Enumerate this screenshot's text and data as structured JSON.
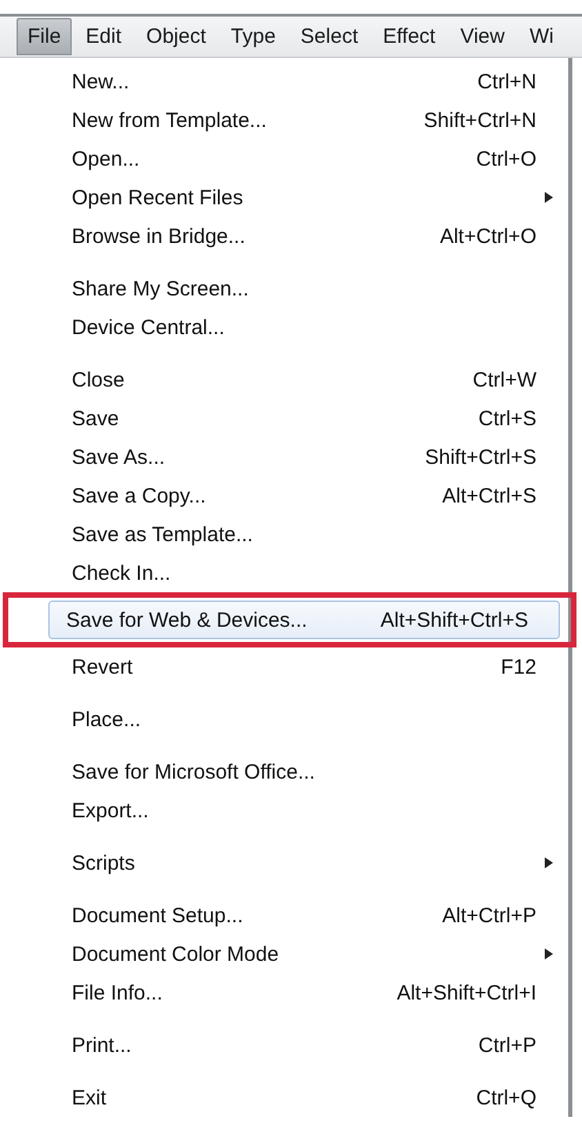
{
  "menu_bar": [
    {
      "label": "File",
      "selected": true
    },
    {
      "label": "Edit",
      "selected": false
    },
    {
      "label": "Object",
      "selected": false
    },
    {
      "label": "Type",
      "selected": false
    },
    {
      "label": "Select",
      "selected": false
    },
    {
      "label": "Effect",
      "selected": false
    },
    {
      "label": "View",
      "selected": false
    },
    {
      "label": "Wi",
      "selected": false
    }
  ],
  "file_menu": {
    "groups": [
      [
        {
          "label": "New...",
          "shortcut": "Ctrl+N",
          "submenu": false,
          "selected": false
        },
        {
          "label": "New from Template...",
          "shortcut": "Shift+Ctrl+N",
          "submenu": false,
          "selected": false
        },
        {
          "label": "Open...",
          "shortcut": "Ctrl+O",
          "submenu": false,
          "selected": false
        },
        {
          "label": "Open Recent Files",
          "submenu": true,
          "selected": false
        },
        {
          "label": "Browse in Bridge...",
          "shortcut": "Alt+Ctrl+O",
          "submenu": false,
          "selected": false
        }
      ],
      [
        {
          "label": "Share My Screen...",
          "submenu": false,
          "selected": false
        },
        {
          "label": "Device Central...",
          "submenu": false,
          "selected": false
        }
      ],
      [
        {
          "label": "Close",
          "shortcut": "Ctrl+W",
          "submenu": false,
          "selected": false
        },
        {
          "label": "Save",
          "shortcut": "Ctrl+S",
          "submenu": false,
          "selected": false
        },
        {
          "label": "Save As...",
          "shortcut": "Shift+Ctrl+S",
          "submenu": false,
          "selected": false
        },
        {
          "label": "Save a Copy...",
          "shortcut": "Alt+Ctrl+S",
          "submenu": false,
          "selected": false
        },
        {
          "label": "Save as Template...",
          "submenu": false,
          "selected": false
        },
        {
          "label": "Check In...",
          "submenu": false,
          "selected": false
        },
        {
          "label": "Save for Web & Devices...",
          "shortcut": "Alt+Shift+Ctrl+S",
          "submenu": false,
          "selected": true
        },
        {
          "label": "Revert",
          "shortcut": "F12",
          "submenu": false,
          "selected": false
        }
      ],
      [
        {
          "label": "Place...",
          "submenu": false,
          "selected": false
        }
      ],
      [
        {
          "label": "Save for Microsoft Office...",
          "submenu": false,
          "selected": false
        },
        {
          "label": "Export...",
          "submenu": false,
          "selected": false
        }
      ],
      [
        {
          "label": "Scripts",
          "submenu": true,
          "selected": false
        }
      ],
      [
        {
          "label": "Document Setup...",
          "shortcut": "Alt+Ctrl+P",
          "submenu": false,
          "selected": false
        },
        {
          "label": "Document Color Mode",
          "submenu": true,
          "selected": false
        },
        {
          "label": "File Info...",
          "shortcut": "Alt+Shift+Ctrl+I",
          "submenu": false,
          "selected": false
        }
      ],
      [
        {
          "label": "Print...",
          "shortcut": "Ctrl+P",
          "submenu": false,
          "selected": false
        }
      ],
      [
        {
          "label": "Exit",
          "shortcut": "Ctrl+Q",
          "submenu": false,
          "selected": false
        }
      ]
    ]
  }
}
